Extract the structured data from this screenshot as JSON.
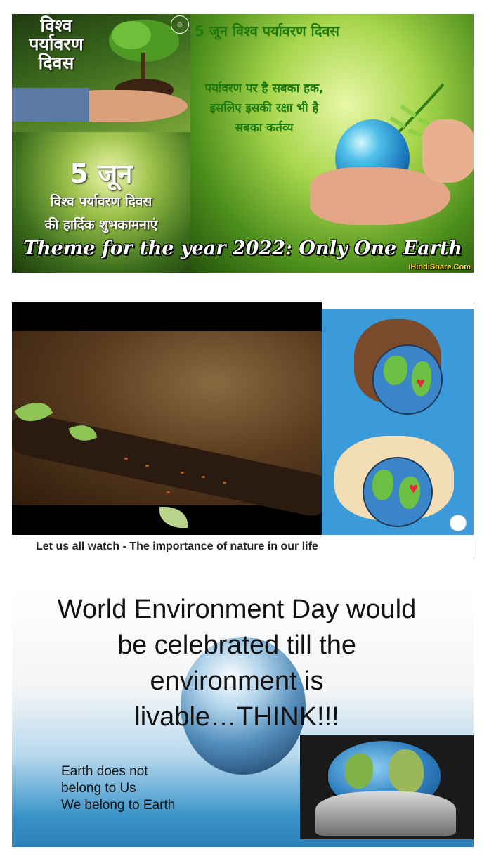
{
  "panel1": {
    "tl_title": [
      "विश्व",
      "पर्यावरण",
      "दिवस"
    ],
    "bl_date": "5 जून",
    "bl_line1": "विश्व पर्यावरण दिवस",
    "bl_line2": "की हार्दिक शुभकामनाएं",
    "right_heading": "5 जून विश्व पर्यावरण दिवस",
    "right_quote": [
      "पर्यावरण पर है सबका हक,",
      "इसलिए इसकी रक्षा भी है",
      "सबका कर्तव्य"
    ],
    "theme": "Theme for the year 2022: Only One Earth",
    "watermark": "iHindiShare.Com"
  },
  "panel2": {
    "caption": "Let us all watch - The importance of nature in our life"
  },
  "panel3": {
    "headline": [
      "World Environment Day would",
      "be celebrated till the",
      "environment is",
      "livable…THINK!!!"
    ],
    "sub": [
      "Earth does not",
      "belong to Us",
      "We belong to Earth"
    ]
  }
}
